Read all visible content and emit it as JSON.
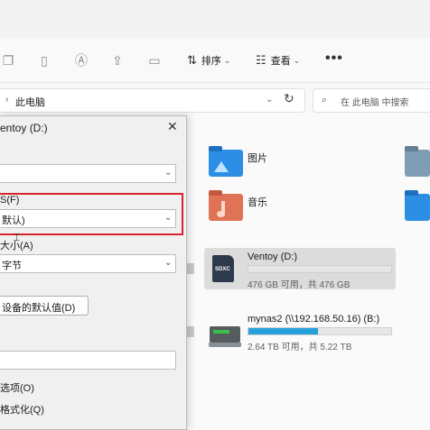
{
  "toolbar": {
    "icons": [
      "copy-icon",
      "paste-icon",
      "rename-icon",
      "share-icon",
      "delete-icon"
    ],
    "sort_label": "排序",
    "view_label": "查看",
    "more_label": "•••"
  },
  "address": {
    "chevron": "›",
    "path": "此电脑",
    "dropdown": "⌄",
    "refresh": "↻"
  },
  "search": {
    "icon": "⌕",
    "placeholder": "在 此电脑 中搜索"
  },
  "folders": [
    {
      "label": "图片",
      "color": "#2d8ee6"
    },
    {
      "label": "音乐",
      "color": "#e07256"
    }
  ],
  "drives": [
    {
      "name": "Ventoy (D:)",
      "detail": "476 GB 可用，共 476 GB",
      "used_fraction": 0.0,
      "badge": "SDXC"
    },
    {
      "name": "mynas2 (\\\\192.168.50.16) (B:)",
      "detail": "2.64 TB 可用，共 5.22 TB",
      "used_fraction": 0.49
    }
  ],
  "dialog": {
    "title": "entoy (D:)",
    "close": "✕",
    "file_system_label": "S(F)",
    "file_system_value": "默认)",
    "unit_size_label": "大小(A)",
    "unit_size_value": "字节",
    "restore_defaults": "设备的默认值(D)",
    "volume_label_value": "",
    "format_options_label": "选项(O)",
    "quick_format_label": "格式化(Q)",
    "dropdown_glyph": "⌄"
  },
  "colors": {
    "highlight_border": "#d9232e",
    "progress": "#26a0da",
    "accent": "#0067c0"
  }
}
